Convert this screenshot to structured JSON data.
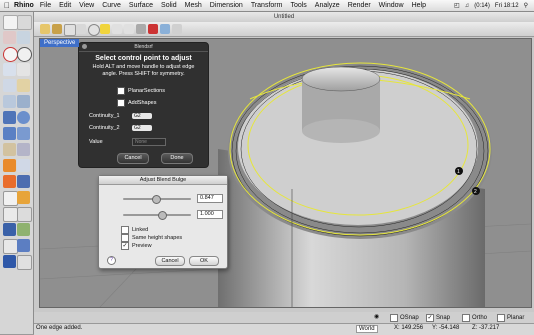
{
  "menubar": {
    "app": "Rhino",
    "items": [
      "File",
      "Edit",
      "View",
      "Curve",
      "Surface",
      "Solid",
      "Mesh",
      "Dimension",
      "Transform",
      "Tools",
      "Analyze",
      "Render",
      "Window",
      "Help"
    ],
    "clock": "Fri 18:12",
    "battery": "(0:14)"
  },
  "window": {
    "title": "Untitled"
  },
  "viewport": {
    "tab": "Perspective"
  },
  "dialog_dark": {
    "title": "Blendsrf",
    "heading": "Select control point to adjust",
    "subtext": "Hold ALT and move handle to adjust edge angle. Press SHIFT for symmetry.",
    "planar_label": "PlanarSections",
    "addshapes_label": "AddShapes",
    "cont1_label": "Continuity_1",
    "cont1_value": "G2",
    "cont2_label": "Continuity_2",
    "cont2_value": "G2",
    "value_label": "Value",
    "value_placeholder": "None",
    "cancel": "Cancel",
    "done": "Done"
  },
  "dialog_light": {
    "title": "Adjust Blend Bulge",
    "value1": "0.847",
    "value2": "1.000",
    "linked": "Linked",
    "same_height": "Same height shapes",
    "preview": "Preview",
    "help": "?",
    "cancel": "Cancel",
    "ok": "OK"
  },
  "snaps": {
    "osnap": "OSnap",
    "snap": "Snap",
    "ortho": "Ortho",
    "planar": "Planar"
  },
  "status": {
    "message": "One edge added.",
    "cplane": "World",
    "x": "X: 149.256",
    "y": "Y: -54.148",
    "z": "Z: -37.217"
  },
  "markers": {
    "one": "1",
    "two": "2"
  },
  "colors": {
    "viewport_tab": "#3f6fc8",
    "curve_highlight": "#e6e63c"
  }
}
